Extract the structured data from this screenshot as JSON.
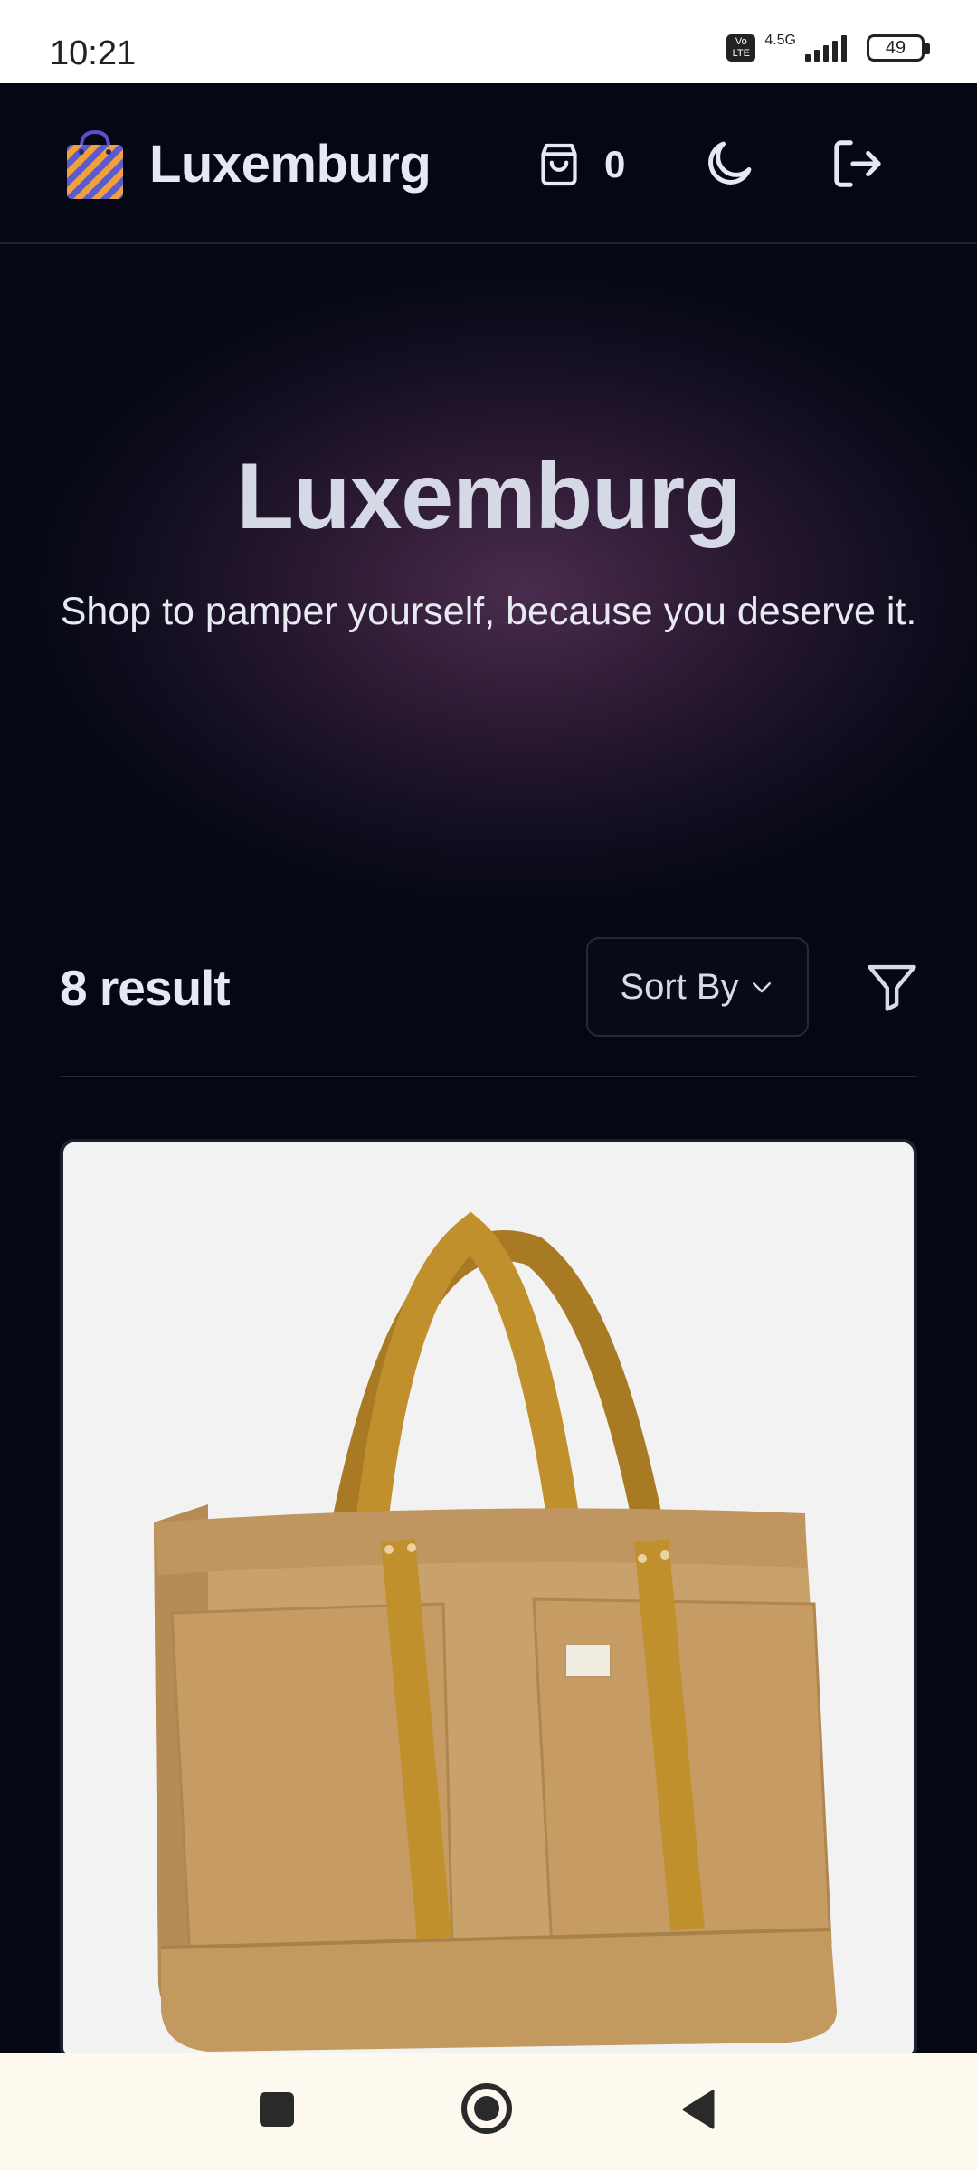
{
  "status_bar": {
    "time": "10:21",
    "volte_label": "Vo LTE",
    "network": "4.5G",
    "battery": "49"
  },
  "header": {
    "brand": "Luxemburg",
    "cart_count": "0",
    "icons": [
      "shopping-bag-logo-icon",
      "cart-icon",
      "moon-icon",
      "logout-icon"
    ]
  },
  "hero": {
    "title": "Luxemburg",
    "subtitle": "Shop to pamper yourself, because you deserve it."
  },
  "results": {
    "count_label": "8 result",
    "sort_label": "Sort By",
    "icons": [
      "chevron-down-icon",
      "filter-icon"
    ]
  },
  "colors": {
    "background": "#050814",
    "hero_glow": "#4a2c4d",
    "text": "#e6e9f2",
    "product_bag": "#c9a16a",
    "product_straps": "#c0902c",
    "nav_bar": "#fdf9ef"
  },
  "nav_bar": {
    "icons": [
      "recents-icon",
      "home-icon",
      "back-icon"
    ]
  }
}
